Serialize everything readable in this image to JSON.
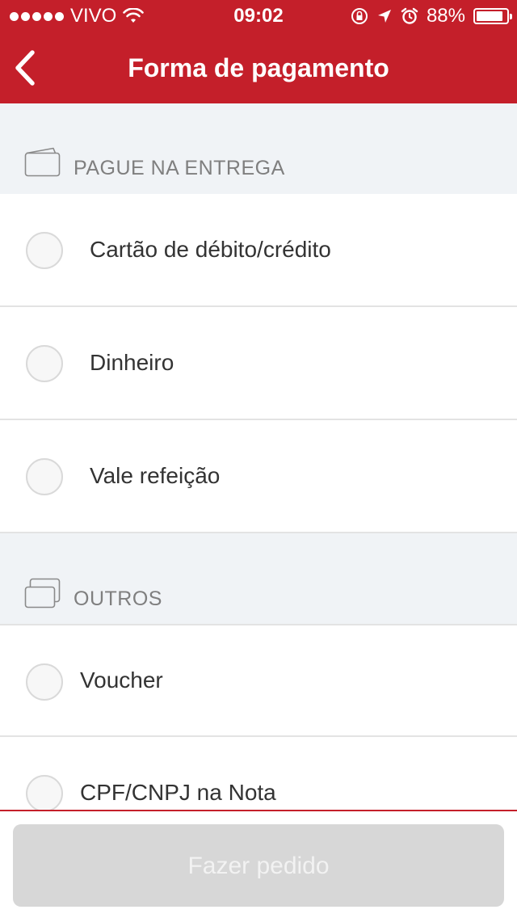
{
  "status_bar": {
    "carrier": "VIVO",
    "time": "09:02",
    "battery": "88%",
    "battery_level": 0.88,
    "icons": [
      "wifi-icon",
      "orientation-lock-icon",
      "location-arrow-icon",
      "alarm-icon"
    ]
  },
  "header": {
    "title": "Forma de pagamento",
    "back_icon": "chevron-left-icon"
  },
  "sections": {
    "delivery": {
      "label": "PAGUE NA ENTREGA",
      "icon": "wallet-icon",
      "options": [
        {
          "label": "Cartão de débito/crédito",
          "selected": false
        },
        {
          "label": "Dinheiro",
          "selected": false
        },
        {
          "label": "Vale refeição",
          "selected": false
        }
      ]
    },
    "others": {
      "label": "OUTROS",
      "icon": "cards-icon",
      "options": [
        {
          "label": "Voucher",
          "selected": false
        },
        {
          "label": "CPF/CNPJ na Nota",
          "selected": false
        }
      ]
    }
  },
  "footer": {
    "submit_label": "Fazer pedido",
    "submit_enabled": false
  },
  "colors": {
    "brand_red": "#c41f2a",
    "section_bg": "#f0f3f6",
    "disabled_button": "#d7d7d7"
  }
}
